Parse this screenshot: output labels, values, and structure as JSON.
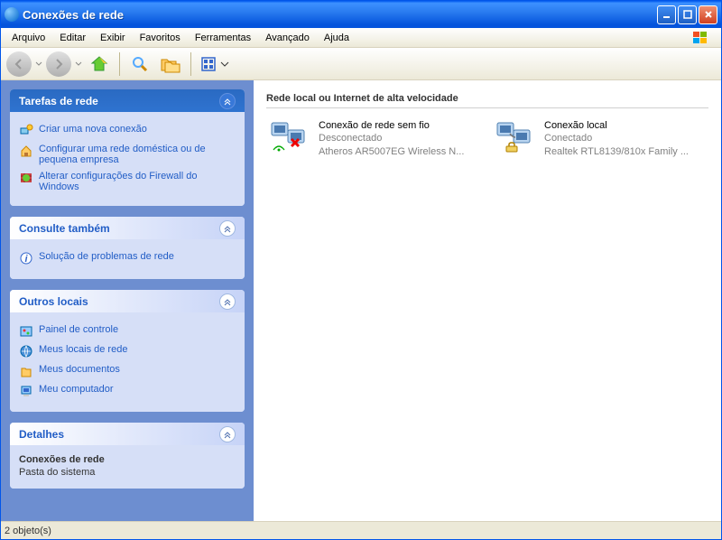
{
  "titlebar": {
    "title": "Conexões de rede"
  },
  "menu": {
    "items": [
      "Arquivo",
      "Editar",
      "Exibir",
      "Favoritos",
      "Ferramentas",
      "Avançado",
      "Ajuda"
    ]
  },
  "sidebar": {
    "tasks": {
      "title": "Tarefas de rede",
      "items": [
        "Criar uma nova conexão",
        "Configurar uma rede doméstica ou de pequena empresa",
        "Alterar configurações do Firewall do Windows"
      ]
    },
    "see_also": {
      "title": "Consulte também",
      "items": [
        "Solução de problemas de rede"
      ]
    },
    "other_places": {
      "title": "Outros locais",
      "items": [
        "Painel de controle",
        "Meus locais de rede",
        "Meus documentos",
        "Meu computador"
      ]
    },
    "details": {
      "title": "Detalhes",
      "name": "Conexões de rede",
      "type": "Pasta do sistema"
    }
  },
  "main": {
    "section_title": "Rede local ou Internet de alta velocidade",
    "connections": [
      {
        "name": "Conexão de rede sem fio",
        "status": "Desconectado",
        "device": "Atheros AR5007EG Wireless N..."
      },
      {
        "name": "Conexão local",
        "status": "Conectado",
        "device": "Realtek RTL8139/810x Family ..."
      }
    ]
  },
  "statusbar": {
    "text": "2 objeto(s)"
  }
}
